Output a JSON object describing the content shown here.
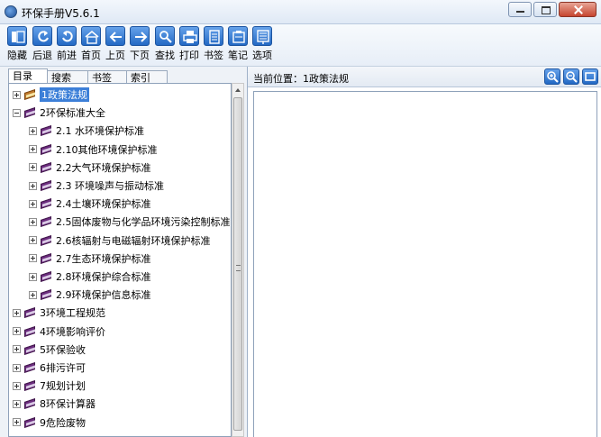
{
  "window": {
    "title": "环保手册V5.6.1"
  },
  "toolbar": {
    "items": [
      {
        "label": "隐藏",
        "icon": "hide-panel-icon"
      },
      {
        "label": "后退",
        "icon": "back-arrow-icon"
      },
      {
        "label": "前进",
        "icon": "forward-arrow-icon"
      },
      {
        "label": "首页",
        "icon": "home-icon"
      },
      {
        "label": "上页",
        "icon": "left-arrow-icon"
      },
      {
        "label": "下页",
        "icon": "right-arrow-icon"
      },
      {
        "label": "查找",
        "icon": "search-icon"
      },
      {
        "label": "打印",
        "icon": "print-icon"
      },
      {
        "label": "书签",
        "icon": "bookmark-icon"
      },
      {
        "label": "笔记",
        "icon": "note-icon"
      },
      {
        "label": "选项",
        "icon": "options-icon"
      }
    ]
  },
  "sidebar": {
    "tabs": [
      {
        "label": "目录",
        "active": true
      },
      {
        "label": "搜索",
        "active": false
      },
      {
        "label": "书签",
        "active": false
      },
      {
        "label": "索引",
        "active": false
      }
    ],
    "tree": [
      {
        "label": "1政策法规",
        "level": 0,
        "expanded": false,
        "selected": true,
        "open_book": true
      },
      {
        "label": "2环保标准大全",
        "level": 0,
        "expanded": true
      },
      {
        "label": "2.1 水环境保护标准",
        "level": 1
      },
      {
        "label": "2.10其他环境保护标准",
        "level": 1
      },
      {
        "label": "2.2大气环境保护标准",
        "level": 1
      },
      {
        "label": "2.3 环境噪声与振动标准",
        "level": 1
      },
      {
        "label": "2.4土壤环境保护标准",
        "level": 1
      },
      {
        "label": "2.5固体废物与化学品环境污染控制标准",
        "level": 1
      },
      {
        "label": "2.6核辐射与电磁辐射环境保护标准",
        "level": 1
      },
      {
        "label": "2.7生态环境保护标准",
        "level": 1
      },
      {
        "label": "2.8环境保护综合标准",
        "level": 1
      },
      {
        "label": "2.9环境保护信息标准",
        "level": 1
      },
      {
        "label": "3环境工程规范",
        "level": 0
      },
      {
        "label": "4环境影响评价",
        "level": 0
      },
      {
        "label": "5环保验收",
        "level": 0
      },
      {
        "label": "6排污许可",
        "level": 0
      },
      {
        "label": "7规划计划",
        "level": 0
      },
      {
        "label": "8环保计算器",
        "level": 0
      },
      {
        "label": "9危险废物",
        "level": 0
      }
    ]
  },
  "location": {
    "label": "当前位置：",
    "value": "1政策法规"
  },
  "colors": {
    "accent": "#3c7fd8",
    "book": "#6b2c7e",
    "toolbar_icon": "#2369c4"
  }
}
